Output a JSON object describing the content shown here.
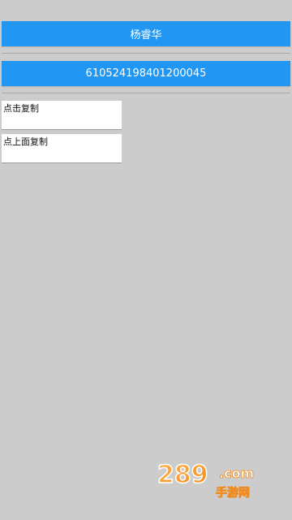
{
  "buttons": {
    "name": "杨睿华",
    "id_number": "610524198401200045"
  },
  "boxes": {
    "first": "点击复制",
    "second": "点上面复制"
  },
  "watermark": {
    "text": "289.com 手游网",
    "color_orange": "#f08a1c",
    "color_white": "#ffffff"
  }
}
